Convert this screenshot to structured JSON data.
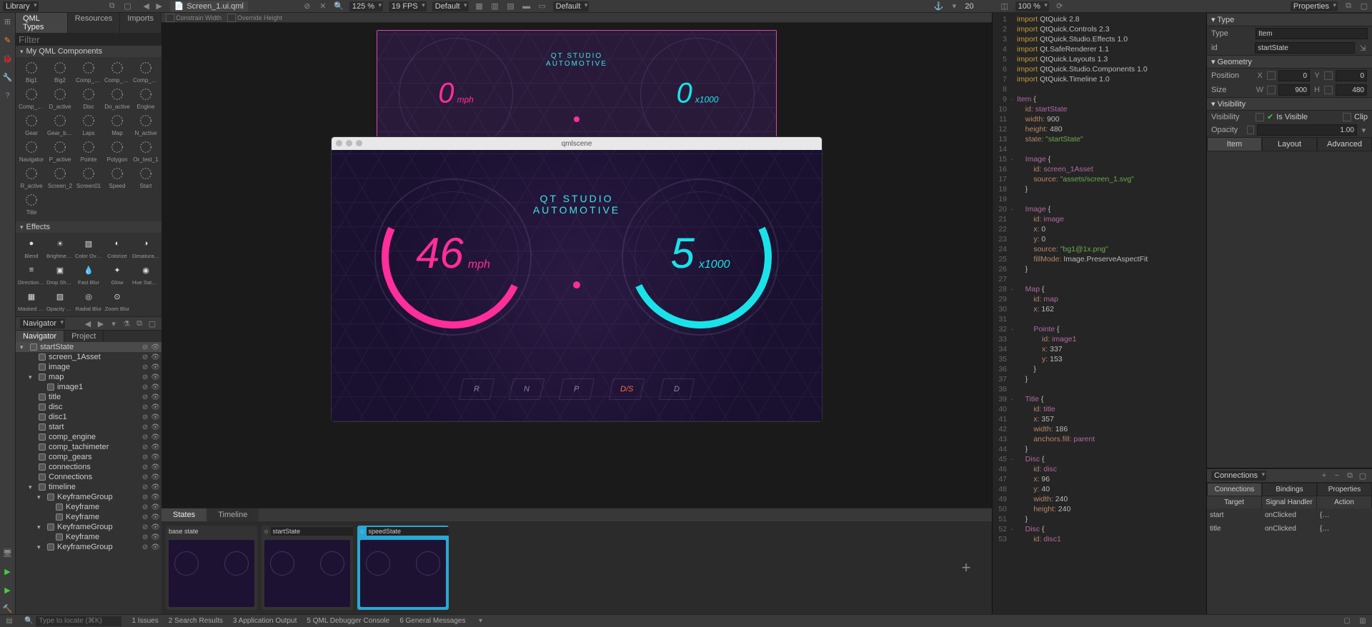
{
  "topbar": {
    "library_label": "Library",
    "filename": "Screen_1.ui.qml",
    "zoom": "125 %",
    "fps": "19 FPS",
    "preset": "Default",
    "preset2": "Default",
    "coord_x": "20",
    "zoom2": "100 %",
    "cb1": "Constrain Width",
    "cb2": "Override Height"
  },
  "library": {
    "tabs": [
      "QML Types",
      "Resources",
      "Imports"
    ],
    "filter_ph": "Filter",
    "section1": "My QML Components",
    "components": [
      "Big1",
      "Big2",
      "Comp_engine",
      "Comp_gears",
      "Comp_…meter",
      "Comp_…ter_2",
      "D_active",
      "Disc",
      "Do_active",
      "Engine",
      "Gear",
      "Gear_break",
      "Laps",
      "Map",
      "N_active",
      "Navigator",
      "P_active",
      "Pointe",
      "Polygon",
      "Or_test_1",
      "R_active",
      "Screen_2",
      "Screen01",
      "Speed",
      "Start",
      "Title"
    ],
    "section2": "Effects",
    "effects": [
      "Blend",
      "Brightness Contrast",
      "Color Overlay",
      "Colorize",
      "Desaturation",
      "Directional Blur",
      "Drop Shadow",
      "Fast Blur",
      "Glow",
      "Hue Saturation",
      "Masked Blur",
      "Opacity Mask",
      "Radial Blur",
      "Zoom Blur"
    ]
  },
  "navigator": {
    "title": "Navigator",
    "tabs": [
      "Navigator",
      "Project"
    ],
    "tree": [
      {
        "d": 0,
        "a": "▾",
        "t": "startState",
        "sel": true
      },
      {
        "d": 1,
        "a": "",
        "t": "screen_1Asset"
      },
      {
        "d": 1,
        "a": "",
        "t": "image"
      },
      {
        "d": 1,
        "a": "▾",
        "t": "map"
      },
      {
        "d": 2,
        "a": "",
        "t": "image1"
      },
      {
        "d": 1,
        "a": "",
        "t": "title"
      },
      {
        "d": 1,
        "a": "",
        "t": "disc"
      },
      {
        "d": 1,
        "a": "",
        "t": "disc1"
      },
      {
        "d": 1,
        "a": "",
        "t": "start"
      },
      {
        "d": 1,
        "a": "",
        "t": "comp_engine"
      },
      {
        "d": 1,
        "a": "",
        "t": "comp_tachimeter"
      },
      {
        "d": 1,
        "a": "",
        "t": "comp_gears"
      },
      {
        "d": 1,
        "a": "",
        "t": "connections"
      },
      {
        "d": 1,
        "a": "",
        "t": "Connections"
      },
      {
        "d": 1,
        "a": "▾",
        "t": "timeline"
      },
      {
        "d": 2,
        "a": "▾",
        "t": "KeyframeGroup"
      },
      {
        "d": 3,
        "a": "",
        "t": "Keyframe"
      },
      {
        "d": 3,
        "a": "",
        "t": "Keyframe"
      },
      {
        "d": 2,
        "a": "▾",
        "t": "KeyframeGroup"
      },
      {
        "d": 3,
        "a": "",
        "t": "Keyframe"
      },
      {
        "d": 2,
        "a": "▾",
        "t": "KeyframeGroup"
      }
    ]
  },
  "canvas": {
    "window_title": "qmlscene",
    "title_l1": "QT STUDIO",
    "title_l2": "AUTOMOTIVE",
    "speed": "46",
    "speed_unit": "mph",
    "tach": "5",
    "tach_unit": "x1000",
    "gears": [
      "R",
      "N",
      "P",
      "D/S",
      "D"
    ],
    "mini_speed": "0",
    "mini_speed_unit": "mph",
    "mini_tach": "0",
    "mini_tach_unit": "x1000"
  },
  "bottom": {
    "tabs": [
      "States",
      "Timeline"
    ],
    "states": [
      "base state",
      "startState",
      "speedState"
    ],
    "add": "+"
  },
  "code": {
    "lines": [
      {
        "n": 1,
        "f": "",
        "t": [
          [
            "kw",
            "import"
          ],
          [
            "plain",
            " QtQuick 2.8"
          ]
        ]
      },
      {
        "n": 2,
        "f": "",
        "t": [
          [
            "kw",
            "import"
          ],
          [
            "plain",
            " QtQuick.Controls 2.3"
          ]
        ]
      },
      {
        "n": 3,
        "f": "",
        "t": [
          [
            "kw",
            "import"
          ],
          [
            "plain",
            " QtQuick.Studio.Effects 1.0"
          ]
        ]
      },
      {
        "n": 4,
        "f": "",
        "t": [
          [
            "kw",
            "import"
          ],
          [
            "plain",
            " Qt.SafeRenderer 1.1"
          ]
        ]
      },
      {
        "n": 5,
        "f": "",
        "t": [
          [
            "kw",
            "import"
          ],
          [
            "plain",
            " QtQuick.Layouts 1.3"
          ]
        ]
      },
      {
        "n": 6,
        "f": "",
        "t": [
          [
            "kw",
            "import"
          ],
          [
            "plain",
            " QtQuick.Studio.Components 1.0"
          ]
        ]
      },
      {
        "n": 7,
        "f": "",
        "t": [
          [
            "kw",
            "import"
          ],
          [
            "plain",
            " QtQuick.Timeline 1.0"
          ]
        ]
      },
      {
        "n": 8,
        "f": "",
        "t": [
          [
            "plain",
            ""
          ]
        ]
      },
      {
        "n": 9,
        "f": "-",
        "t": [
          [
            "typ",
            "Item"
          ],
          [
            "plain",
            " {"
          ]
        ]
      },
      {
        "n": 10,
        "f": "",
        "t": [
          [
            "plain",
            "    "
          ],
          [
            "id",
            "id:"
          ],
          [
            "plain",
            " "
          ],
          [
            "typ",
            "startState"
          ]
        ]
      },
      {
        "n": 11,
        "f": "",
        "t": [
          [
            "plain",
            "    "
          ],
          [
            "id",
            "width:"
          ],
          [
            "plain",
            " 900"
          ]
        ]
      },
      {
        "n": 12,
        "f": "",
        "t": [
          [
            "plain",
            "    "
          ],
          [
            "id",
            "height:"
          ],
          [
            "plain",
            " 480"
          ]
        ]
      },
      {
        "n": 13,
        "f": "",
        "t": [
          [
            "plain",
            "    "
          ],
          [
            "id",
            "state:"
          ],
          [
            "plain",
            " "
          ],
          [
            "str",
            "\"startState\""
          ]
        ]
      },
      {
        "n": 14,
        "f": "",
        "t": [
          [
            "plain",
            ""
          ]
        ]
      },
      {
        "n": 15,
        "f": "-",
        "t": [
          [
            "plain",
            "    "
          ],
          [
            "typ",
            "Image"
          ],
          [
            "plain",
            " {"
          ]
        ]
      },
      {
        "n": 16,
        "f": "",
        "t": [
          [
            "plain",
            "        "
          ],
          [
            "id",
            "id:"
          ],
          [
            "plain",
            " "
          ],
          [
            "typ",
            "screen_1Asset"
          ]
        ]
      },
      {
        "n": 17,
        "f": "",
        "t": [
          [
            "plain",
            "        "
          ],
          [
            "id",
            "source:"
          ],
          [
            "plain",
            " "
          ],
          [
            "str",
            "\"assets/screen_1.svg\""
          ]
        ]
      },
      {
        "n": 18,
        "f": "",
        "t": [
          [
            "plain",
            "    }"
          ]
        ]
      },
      {
        "n": 19,
        "f": "",
        "t": [
          [
            "plain",
            ""
          ]
        ]
      },
      {
        "n": 20,
        "f": "-",
        "t": [
          [
            "plain",
            "    "
          ],
          [
            "typ",
            "Image"
          ],
          [
            "plain",
            " {"
          ]
        ]
      },
      {
        "n": 21,
        "f": "",
        "t": [
          [
            "plain",
            "        "
          ],
          [
            "id",
            "id:"
          ],
          [
            "plain",
            " "
          ],
          [
            "typ",
            "image"
          ]
        ]
      },
      {
        "n": 22,
        "f": "",
        "t": [
          [
            "plain",
            "        "
          ],
          [
            "id",
            "x:"
          ],
          [
            "plain",
            " 0"
          ]
        ]
      },
      {
        "n": 23,
        "f": "",
        "t": [
          [
            "plain",
            "        "
          ],
          [
            "id",
            "y:"
          ],
          [
            "plain",
            " 0"
          ]
        ]
      },
      {
        "n": 24,
        "f": "",
        "t": [
          [
            "plain",
            "        "
          ],
          [
            "id",
            "source:"
          ],
          [
            "plain",
            " "
          ],
          [
            "str",
            "\"bg1@1x.png\""
          ]
        ]
      },
      {
        "n": 25,
        "f": "",
        "t": [
          [
            "plain",
            "        "
          ],
          [
            "id",
            "fillMode:"
          ],
          [
            "plain",
            " Image.PreserveAspectFit"
          ]
        ]
      },
      {
        "n": 26,
        "f": "",
        "t": [
          [
            "plain",
            "    }"
          ]
        ]
      },
      {
        "n": 27,
        "f": "",
        "t": [
          [
            "plain",
            ""
          ]
        ]
      },
      {
        "n": 28,
        "f": "-",
        "t": [
          [
            "plain",
            "    "
          ],
          [
            "typ",
            "Map"
          ],
          [
            "plain",
            " {"
          ]
        ]
      },
      {
        "n": 29,
        "f": "",
        "t": [
          [
            "plain",
            "        "
          ],
          [
            "id",
            "id:"
          ],
          [
            "plain",
            " "
          ],
          [
            "typ",
            "map"
          ]
        ]
      },
      {
        "n": 30,
        "f": "",
        "t": [
          [
            "plain",
            "        "
          ],
          [
            "id",
            "x:"
          ],
          [
            "plain",
            " 162"
          ]
        ]
      },
      {
        "n": 31,
        "f": "",
        "t": [
          [
            "plain",
            ""
          ]
        ]
      },
      {
        "n": 32,
        "f": "-",
        "t": [
          [
            "plain",
            "        "
          ],
          [
            "typ",
            "Pointe"
          ],
          [
            "plain",
            " {"
          ]
        ]
      },
      {
        "n": 33,
        "f": "",
        "t": [
          [
            "plain",
            "            "
          ],
          [
            "id",
            "id:"
          ],
          [
            "plain",
            " "
          ],
          [
            "typ",
            "image1"
          ]
        ]
      },
      {
        "n": 34,
        "f": "",
        "t": [
          [
            "plain",
            "            "
          ],
          [
            "id",
            "x:"
          ],
          [
            "plain",
            " 337"
          ]
        ]
      },
      {
        "n": 35,
        "f": "",
        "t": [
          [
            "plain",
            "            "
          ],
          [
            "id",
            "y:"
          ],
          [
            "plain",
            " 153"
          ]
        ]
      },
      {
        "n": 36,
        "f": "",
        "t": [
          [
            "plain",
            "        }"
          ]
        ]
      },
      {
        "n": 37,
        "f": "",
        "t": [
          [
            "plain",
            "    }"
          ]
        ]
      },
      {
        "n": 38,
        "f": "",
        "t": [
          [
            "plain",
            ""
          ]
        ]
      },
      {
        "n": 39,
        "f": "-",
        "t": [
          [
            "plain",
            "    "
          ],
          [
            "typ",
            "Title"
          ],
          [
            "plain",
            " {"
          ]
        ]
      },
      {
        "n": 40,
        "f": "",
        "t": [
          [
            "plain",
            "        "
          ],
          [
            "id",
            "id:"
          ],
          [
            "plain",
            " "
          ],
          [
            "typ",
            "title"
          ]
        ]
      },
      {
        "n": 41,
        "f": "",
        "t": [
          [
            "plain",
            "        "
          ],
          [
            "id",
            "x:"
          ],
          [
            "plain",
            " 357"
          ]
        ]
      },
      {
        "n": 42,
        "f": "",
        "t": [
          [
            "plain",
            "        "
          ],
          [
            "id",
            "width:"
          ],
          [
            "plain",
            " 186"
          ]
        ]
      },
      {
        "n": 43,
        "f": "",
        "t": [
          [
            "plain",
            "        "
          ],
          [
            "id",
            "anchors.fill:"
          ],
          [
            "plain",
            " "
          ],
          [
            "typ",
            "parent"
          ]
        ]
      },
      {
        "n": 44,
        "f": "",
        "t": [
          [
            "plain",
            "    }"
          ]
        ]
      },
      {
        "n": 45,
        "f": "-",
        "t": [
          [
            "plain",
            "    "
          ],
          [
            "typ",
            "Disc"
          ],
          [
            "plain",
            " {"
          ]
        ]
      },
      {
        "n": 46,
        "f": "",
        "t": [
          [
            "plain",
            "        "
          ],
          [
            "id",
            "id:"
          ],
          [
            "plain",
            " "
          ],
          [
            "typ",
            "disc"
          ]
        ]
      },
      {
        "n": 47,
        "f": "",
        "t": [
          [
            "plain",
            "        "
          ],
          [
            "id",
            "x:"
          ],
          [
            "plain",
            " 96"
          ]
        ]
      },
      {
        "n": 48,
        "f": "",
        "t": [
          [
            "plain",
            "        "
          ],
          [
            "id",
            "y:"
          ],
          [
            "plain",
            " 40"
          ]
        ]
      },
      {
        "n": 49,
        "f": "",
        "t": [
          [
            "plain",
            "        "
          ],
          [
            "id",
            "width:"
          ],
          [
            "plain",
            " 240"
          ]
        ]
      },
      {
        "n": 50,
        "f": "",
        "t": [
          [
            "plain",
            "        "
          ],
          [
            "id",
            "height:"
          ],
          [
            "plain",
            " 240"
          ]
        ]
      },
      {
        "n": 51,
        "f": "",
        "t": [
          [
            "plain",
            "    }"
          ]
        ]
      },
      {
        "n": 52,
        "f": "-",
        "t": [
          [
            "plain",
            "    "
          ],
          [
            "typ",
            "Disc"
          ],
          [
            "plain",
            " {"
          ]
        ]
      },
      {
        "n": 53,
        "f": "",
        "t": [
          [
            "plain",
            "        "
          ],
          [
            "id",
            "id:"
          ],
          [
            "plain",
            " "
          ],
          [
            "typ",
            "disc1"
          ]
        ]
      }
    ]
  },
  "props": {
    "title": "Properties",
    "sec_type": "Type",
    "type_label": "Type",
    "type_value": "Item",
    "id_label": "id",
    "id_value": "startState",
    "sec_geom": "Geometry",
    "pos_label": "Position",
    "x": "0",
    "y": "0",
    "size_label": "Size",
    "w": "900",
    "h": "480",
    "sec_vis": "Visibility",
    "vis_label": "Visibility",
    "vis_cb": "Is Visible",
    "clip": "Clip",
    "op_label": "Opacity",
    "op_val": "1.00",
    "tabs": [
      "Item",
      "Layout",
      "Advanced"
    ]
  },
  "conn": {
    "title": "Connections",
    "tabs": [
      "Connections",
      "Bindings",
      "Properties"
    ],
    "cols": [
      "Target",
      "Signal Handler",
      "Action"
    ],
    "rows": [
      {
        "t": "start",
        "s": "onClicked",
        "a": "{…"
      },
      {
        "t": "title",
        "s": "onClicked",
        "a": "{…"
      }
    ]
  },
  "status": {
    "search_ph": "Type to locate (⌘K)",
    "items": [
      "1  Issues",
      "2  Search Results",
      "3  Application Output",
      "5  QML Debugger Console",
      "6  General Messages"
    ]
  }
}
